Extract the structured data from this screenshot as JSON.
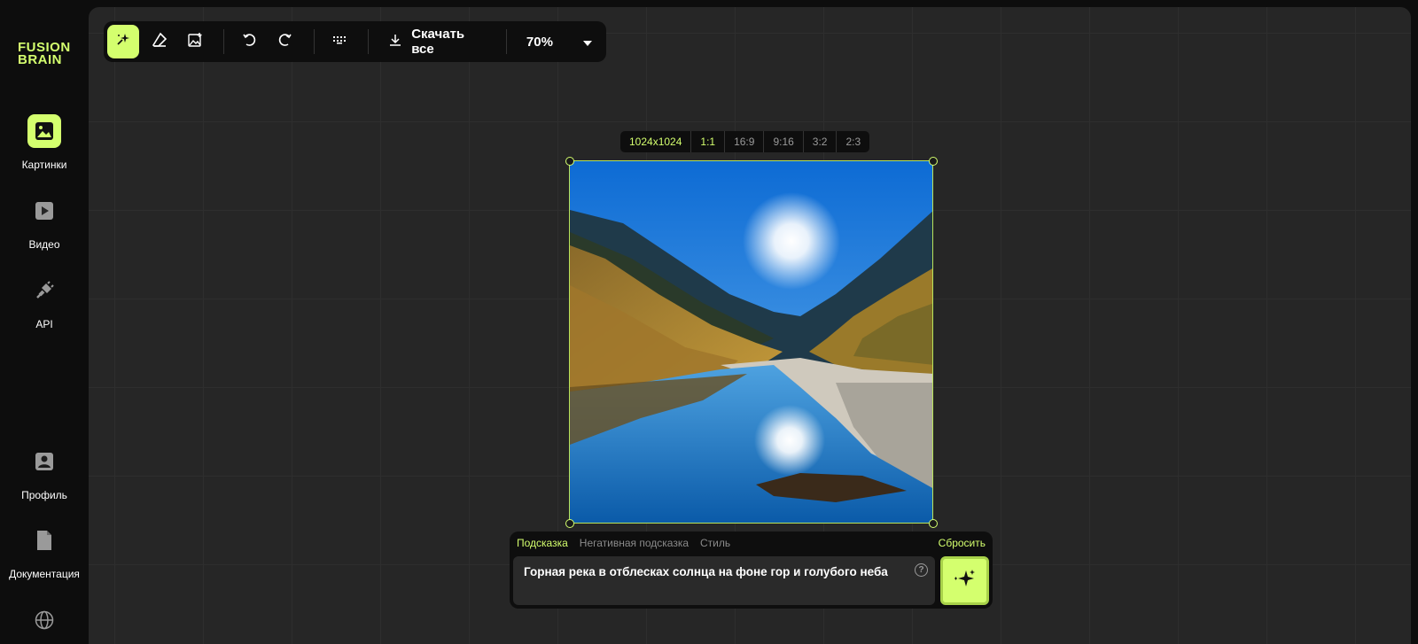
{
  "brand": {
    "line1": "FUSION",
    "line2": "BRAIN",
    "accent": "#d4ff6e"
  },
  "sidebar": {
    "items": [
      {
        "label": "Картинки",
        "icon": "image-icon",
        "active": true
      },
      {
        "label": "Видео",
        "icon": "video-icon",
        "active": false
      },
      {
        "label": "API",
        "icon": "plug-icon",
        "active": false
      },
      {
        "label": "Профиль",
        "icon": "profile-icon",
        "active": false
      },
      {
        "label": "Документация",
        "icon": "document-icon",
        "active": false
      }
    ],
    "bottom_icon": "globe-icon"
  },
  "toolbar": {
    "tools": [
      "magic-generate-icon",
      "eraser-icon",
      "add-image-icon",
      "undo-icon",
      "redo-icon",
      "keyboard-icon"
    ],
    "download_label": "Скачать все",
    "zoom": "70%"
  },
  "ratio": {
    "resolution": "1024x1024",
    "options": [
      "1:1",
      "16:9",
      "9:16",
      "3:2",
      "2:3"
    ],
    "selected": "1:1"
  },
  "prompt": {
    "tabs": [
      "Подсказка",
      "Негативная подсказка",
      "Стиль"
    ],
    "active_tab": "Подсказка",
    "reset_label": "Сбросить",
    "text": "Горная река в отблесках солнца на фоне гор и голубого неба",
    "help": "?"
  }
}
